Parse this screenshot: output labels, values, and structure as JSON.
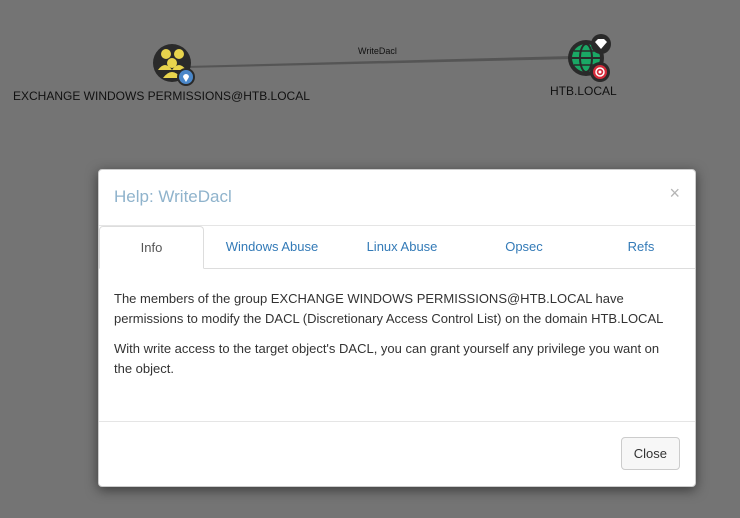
{
  "graph": {
    "source_node_label": "EXCHANGE WINDOWS PERMISSIONS@HTB.LOCAL",
    "target_node_label": "HTB.LOCAL",
    "edge_label": "WriteDacl",
    "colors": {
      "background": "#747474",
      "group_node": "#e8d44d",
      "domain_node": "#1aa865",
      "badge_blue": "#4a87c9",
      "badge_red": "#d52b3a"
    }
  },
  "modal": {
    "title": "Help: WriteDacl",
    "close_symbol": "×",
    "tabs": [
      {
        "label": "Info"
      },
      {
        "label": "Windows Abuse"
      },
      {
        "label": "Linux Abuse"
      },
      {
        "label": "Opsec"
      },
      {
        "label": "Refs"
      }
    ],
    "active_tab": "Info",
    "body": {
      "paragraph1": "The members of the group EXCHANGE WINDOWS PERMISSIONS@HTB.LOCAL have permissions to modify the DACL (Discretionary Access Control List) on the domain HTB.LOCAL",
      "paragraph2": "With write access to the target object's DACL, you can grant yourself any privilege you want on the object."
    },
    "footer": {
      "close_label": "Close"
    }
  }
}
